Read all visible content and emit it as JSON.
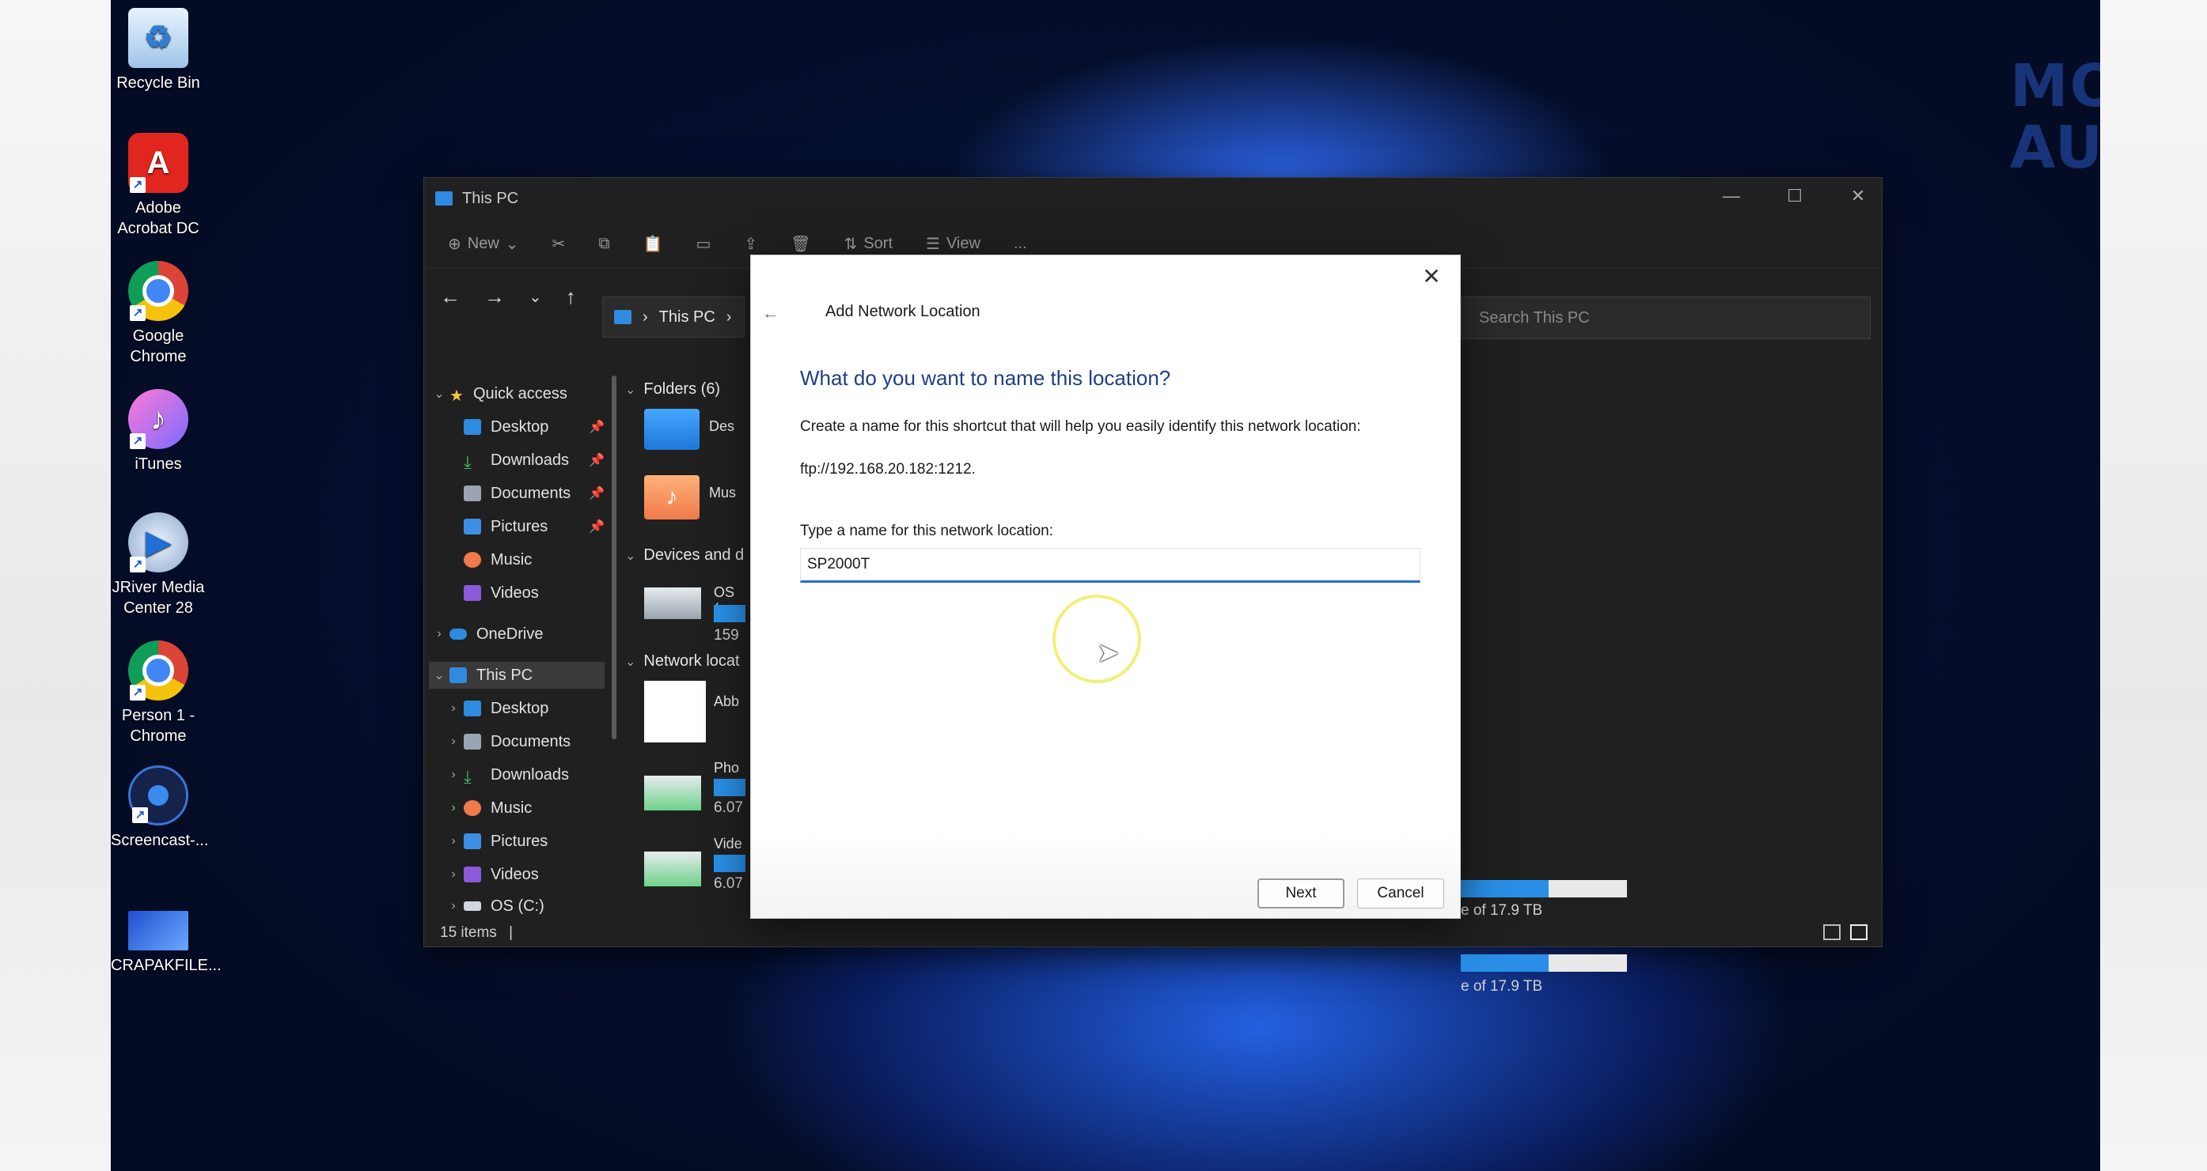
{
  "desktop": {
    "icons": [
      {
        "label": "Recycle Bin"
      },
      {
        "label": "Adobe Acrobat DC"
      },
      {
        "label": "Google Chrome"
      },
      {
        "label": "iTunes"
      },
      {
        "label": "JRiver Media Center 28"
      },
      {
        "label": "Person 1 - Chrome"
      },
      {
        "label": "Screencast-..."
      },
      {
        "label": "CRAPAKFILE..."
      }
    ],
    "watermark_line1": "MOON",
    "watermark_line2": "AUDIO"
  },
  "explorer": {
    "title": "This PC",
    "toolbar": {
      "new_label": "New",
      "sort_label": "Sort",
      "view_label": "View",
      "more_label": "..."
    },
    "address": {
      "root": "This PC"
    },
    "search_placeholder": "Search This PC",
    "nav": {
      "quick_access": "Quick access",
      "quick_items": [
        "Desktop",
        "Downloads",
        "Documents",
        "Pictures",
        "Music",
        "Videos"
      ],
      "onedrive": "OneDrive",
      "this_pc": "This PC",
      "pc_items": [
        "Desktop",
        "Documents",
        "Downloads",
        "Music",
        "Pictures",
        "Videos",
        "OS (C:)"
      ]
    },
    "content": {
      "folders_header": "Folders (6)",
      "folder1_label": "Des",
      "folder2_label": "Mus",
      "devices_header": "Devices and d",
      "device_label": "OS (",
      "device_size": "159",
      "network_header": "Network locat",
      "net1_label": "Abb",
      "net2_label": "Pho",
      "net2_size": "6.07",
      "net3_label": "Vide",
      "net3_size": "6.07",
      "right_size1": "e of 17.9 TB",
      "right_size2": "e of 17.9 TB",
      "right_fill1": 0.53,
      "right_fill2": 0.53
    },
    "status": "15 items"
  },
  "dialog": {
    "title": "Add Network Location",
    "heading": "What do you want to name this location?",
    "description": "Create a name for this shortcut that will help you easily identify this network location:",
    "address": "ftp://192.168.20.182:1212.",
    "field_label": "Type a name for this network location:",
    "field_value": "SP2000T",
    "next_label": "Next",
    "cancel_label": "Cancel"
  }
}
